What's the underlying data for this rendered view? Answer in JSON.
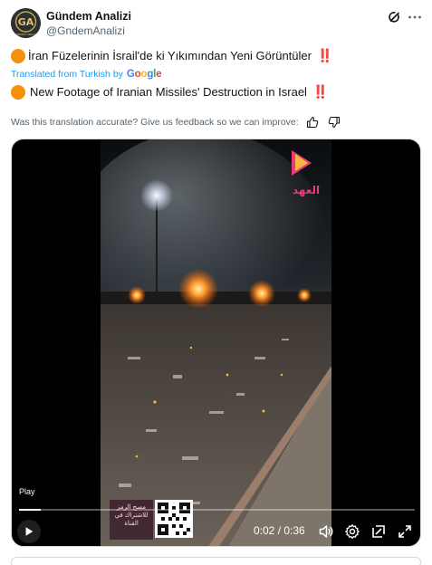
{
  "account": {
    "display_name": "Gündem Analizi",
    "handle": "@GndemAnalizi",
    "avatar_letters": "GA",
    "avatar_caption": "GÜNDEM ANALİZİ"
  },
  "tweet": {
    "original_text": "İran Füzelerinin İsrail'de ki Yıkımından Yeni Görüntüler",
    "translated_prefix": "Translated from Turkish by",
    "google_letters": [
      "G",
      "o",
      "o",
      "g",
      "l",
      "e"
    ],
    "translated_text": "New Footage of Iranian Missiles' Destruction in Israel",
    "emphasis": "‼️",
    "feedback_prompt": "Was this translation accurate? Give us feedback so we can improve:"
  },
  "video": {
    "play_label": "Play",
    "current_time": "0:02",
    "separator": " / ",
    "duration": "0:36",
    "progress_fraction": 0.055,
    "banner_text": "مسح الرمز للاشتراك في القناة",
    "watermark_text": "العهد"
  },
  "icons": {
    "grok": "grok-icon",
    "more": "more-icon",
    "thumb_up": "thumbs-up-icon",
    "thumb_down": "thumbs-down-icon",
    "play": "play-icon",
    "volume": "volume-icon",
    "settings": "settings-icon",
    "pip": "picture-in-picture-icon",
    "fullscreen": "fullscreen-icon"
  },
  "colors": {
    "text_primary": "#0f1419",
    "text_secondary": "#536471",
    "link_blue": "#1d9bf0",
    "emoji_orange": "#f4900c",
    "emphasis_red": "#dd2e44"
  }
}
